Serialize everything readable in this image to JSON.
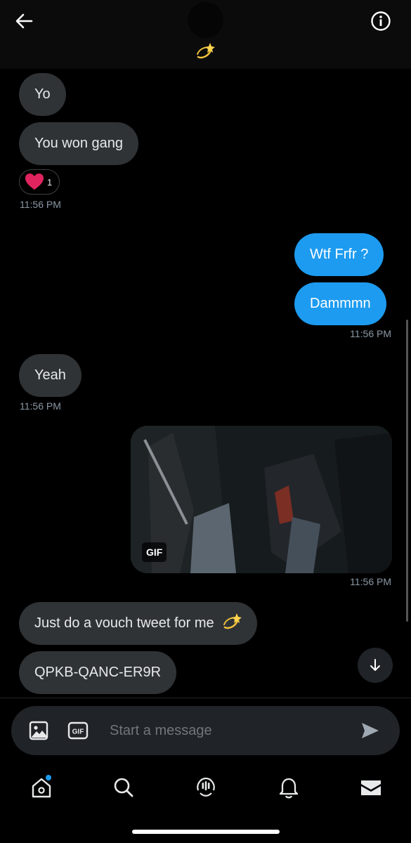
{
  "header": {
    "back_icon": "arrow-left-icon",
    "avatar": "user-avatar",
    "name_emoji": "dizzy-emoji",
    "info_icon": "info-icon"
  },
  "messages": [
    {
      "side": "received",
      "text": "Yo"
    },
    {
      "side": "received",
      "text": "You won gang"
    },
    {
      "side": "received",
      "reaction": {
        "icon": "heart-emoji",
        "count": "1"
      },
      "time": "11:56 PM"
    },
    {
      "side": "sent",
      "text": "Wtf Frfr ?"
    },
    {
      "side": "sent",
      "text": "Dammmn",
      "time": "11:56 PM"
    },
    {
      "side": "received",
      "text": "Yeah",
      "time": "11:56 PM"
    },
    {
      "side": "sent",
      "media": "gif",
      "badge": "GIF",
      "time": "11:56 PM"
    },
    {
      "side": "received",
      "text": "Just do a vouch tweet for me",
      "emoji": "dizzy-emoji"
    },
    {
      "side": "received",
      "text": "QPKB-QANC-ER9R"
    }
  ],
  "thread": {
    "m0": "Yo",
    "m1": "You won gang",
    "m1_reaction_count": "1",
    "m1_time": "11:56 PM",
    "m2": "Wtf Frfr ?",
    "m3": "Dammmn",
    "m3_time": "11:56 PM",
    "m4": "Yeah",
    "m4_time": "11:56 PM",
    "gif_badge": "GIF",
    "gif_time": "11:56 PM",
    "m5": "Just do a vouch tweet for me",
    "m6": "QPKB-QANC-ER9R"
  },
  "jump_button_icon": "arrow-down-icon",
  "composer": {
    "placeholder": "Start a message",
    "value": "",
    "image_icon": "image-icon",
    "gif_icon": "gif-icon",
    "gif_icon_label": "GIF",
    "send_icon": "send-icon"
  },
  "nav": [
    {
      "name": "home",
      "icon": "home-icon",
      "has_dot": true
    },
    {
      "name": "search",
      "icon": "search-icon"
    },
    {
      "name": "spaces",
      "icon": "spaces-icon"
    },
    {
      "name": "notifications",
      "icon": "bell-icon"
    },
    {
      "name": "messages",
      "icon": "mail-icon",
      "active": true
    }
  ],
  "colors": {
    "background": "#000000",
    "sent_bubble": "#1d9bf0",
    "received_bubble": "#2f3336",
    "timestamp": "#8b98a5",
    "heart": "#e0245e"
  }
}
